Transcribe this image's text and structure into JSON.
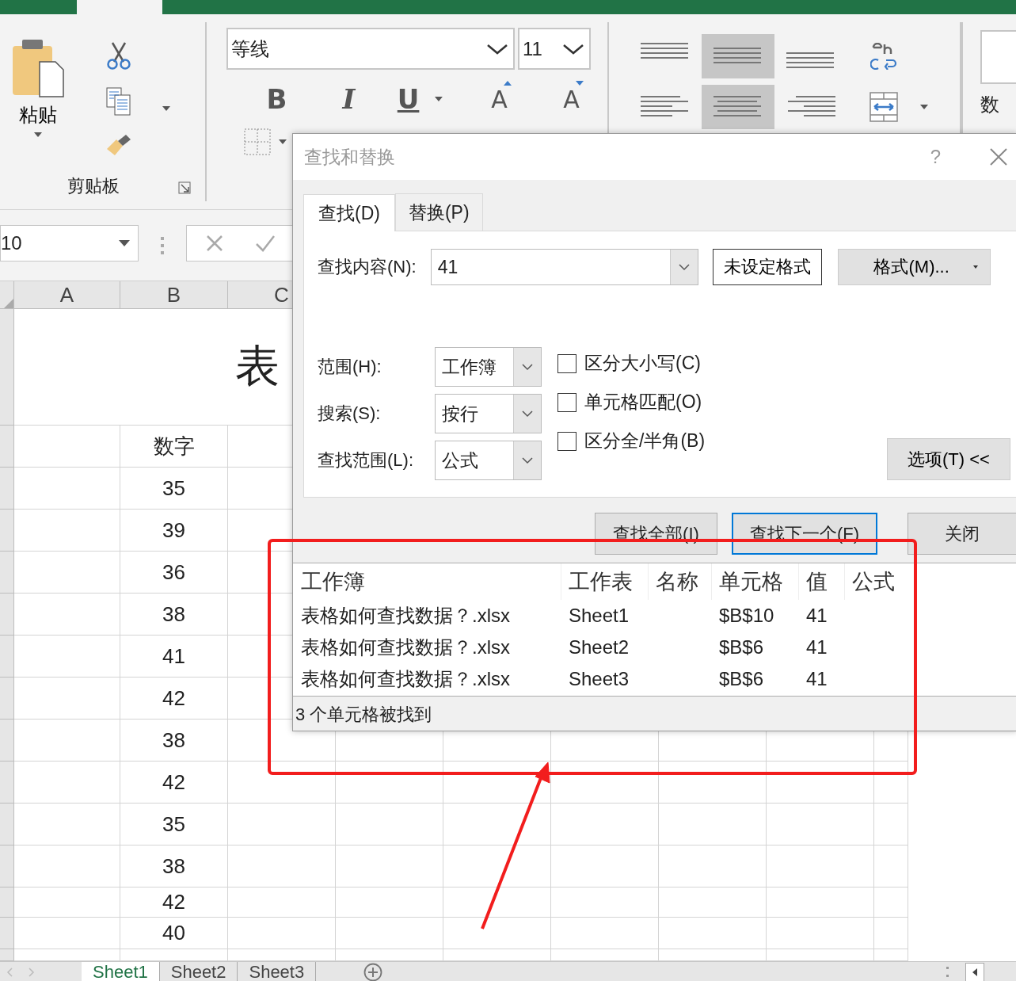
{
  "ribbon": {
    "clipboard": {
      "paste_label": "粘贴",
      "group_label": "剪贴板"
    },
    "font": {
      "font_name": "等线",
      "font_size": "11",
      "style_buttons": [
        {
          "kind": "bold",
          "label": "B"
        },
        {
          "kind": "italic",
          "label": "I"
        },
        {
          "kind": "underline",
          "label": "U"
        },
        {
          "kind": "grow",
          "label": "A"
        },
        {
          "kind": "shrink",
          "label": "A"
        }
      ]
    },
    "alignment": {
      "vertical": [
        {
          "kind": "top",
          "selected": false
        },
        {
          "kind": "middle",
          "selected": true
        },
        {
          "kind": "bottom",
          "selected": false
        }
      ],
      "horizontal": [
        {
          "kind": "left",
          "selected": false
        },
        {
          "kind": "center",
          "selected": true
        },
        {
          "kind": "right",
          "selected": false
        }
      ]
    },
    "number": {
      "group_label": "数"
    }
  },
  "formula_bar": {
    "name_box": "10"
  },
  "sheet": {
    "columns": [
      "A",
      "B",
      "C"
    ],
    "title": "表",
    "header": "数字",
    "values": [
      "35",
      "39",
      "36",
      "38",
      "41",
      "42",
      "38",
      "42",
      "35",
      "38",
      "42",
      "40"
    ]
  },
  "sheet_tabs": [
    {
      "label": "Sheet1",
      "selected": true
    },
    {
      "label": "Sheet2",
      "selected": false
    },
    {
      "label": "Sheet3",
      "selected": false
    }
  ],
  "dialog": {
    "title": "查找和替换",
    "help": "?",
    "tabs": [
      {
        "label": "查找(D)",
        "selected": true
      },
      {
        "label": "替换(P)",
        "selected": false
      }
    ],
    "find_label": "查找内容(N):",
    "find_value": "41",
    "format_preview": "未设定格式",
    "format_button": "格式(M)...",
    "options": [
      {
        "label": "范围(H):",
        "value": "工作簿"
      },
      {
        "label": "搜索(S):",
        "value": "按行"
      },
      {
        "label": "查找范围(L):",
        "value": "公式"
      }
    ],
    "checkboxes": [
      {
        "label": "区分大小写(C)",
        "checked": false
      },
      {
        "label": "单元格匹配(O)",
        "checked": false
      },
      {
        "label": "区分全/半角(B)",
        "checked": false
      }
    ],
    "options_button": "选项(T) <<",
    "buttons": [
      {
        "label": "查找全部(I)",
        "default": false
      },
      {
        "label": "查找下一个(F)",
        "default": true
      },
      {
        "label": "关闭",
        "default": false
      }
    ],
    "results": {
      "columns": [
        "工作簿",
        "工作表",
        "名称",
        "单元格",
        "值",
        "公式"
      ],
      "rows": [
        {
          "workbook": "表格如何查找数据？.xlsx",
          "sheet": "Sheet1",
          "cell": "$B$10",
          "value": "41"
        },
        {
          "workbook": "表格如何查找数据？.xlsx",
          "sheet": "Sheet2",
          "cell": "$B$6",
          "value": "41"
        },
        {
          "workbook": "表格如何查找数据？.xlsx",
          "sheet": "Sheet3",
          "cell": "$B$6",
          "value": "41"
        }
      ]
    },
    "status": "3 个单元格被找到"
  }
}
